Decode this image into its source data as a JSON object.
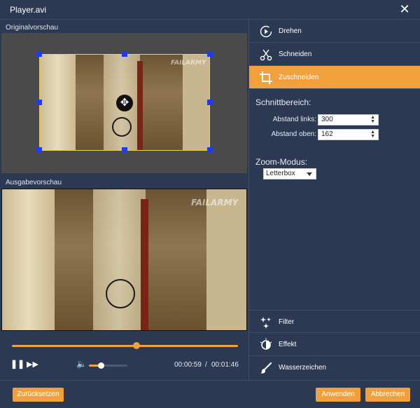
{
  "window": {
    "title": "Player.avi",
    "close_icon": "close-icon"
  },
  "left": {
    "original_label": "Originalvorschau",
    "output_label": "Ausgabevorschau",
    "watermark_text": "FAILARMY"
  },
  "player": {
    "progress_fraction": 0.55,
    "volume_fraction": 0.3,
    "current_time": "00:00:59",
    "separator": "/",
    "total_time": "00:01:46"
  },
  "menu": {
    "items": [
      {
        "label": "Drehen",
        "icon": "rotate-icon"
      },
      {
        "label": "Schneiden",
        "icon": "scissors-icon"
      },
      {
        "label": "Zuschneiden",
        "icon": "crop-icon",
        "active": true
      }
    ],
    "bottom_items": [
      {
        "label": "Filter",
        "icon": "sparkle-icon"
      },
      {
        "label": "Effekt",
        "icon": "effect-icon"
      },
      {
        "label": "Wasserzeichen",
        "icon": "brush-icon"
      }
    ]
  },
  "crop": {
    "heading": "Schnittbereich:",
    "left_label": "Abstand links:",
    "left_value": "300",
    "top_label": "Abstand oben:",
    "top_value": "162"
  },
  "zoom": {
    "heading": "Zoom-Modus:",
    "selected": "Letterbox"
  },
  "footer": {
    "reset_label": "Zurücksetzen",
    "apply_label": "Anwenden",
    "cancel_label": "Abbrechen"
  },
  "colors": {
    "accent": "#f2a03c",
    "background": "#2b3a52",
    "handle": "#1a3cff",
    "crop_border": "#e8d64a"
  }
}
